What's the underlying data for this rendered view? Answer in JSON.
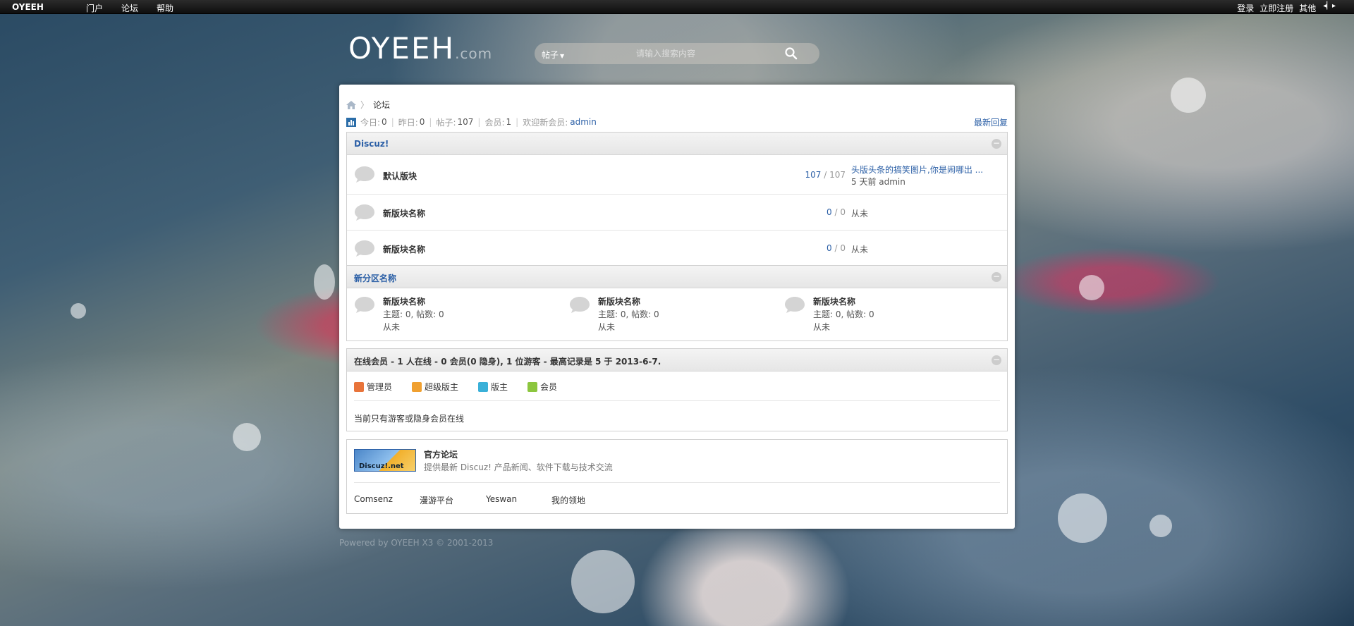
{
  "topbar": {
    "brand": "OYEEH",
    "nav": [
      "门户",
      "论坛",
      "帮助"
    ],
    "right": [
      "登录",
      "立即注册",
      "其他"
    ]
  },
  "header": {
    "logo": "OYEEH",
    "logo_suffix": ".com",
    "search_type": "帖子",
    "search_placeholder": "请输入搜索内容"
  },
  "breadcrumb": {
    "current": "论坛"
  },
  "stats": {
    "today_label": "今日:",
    "today": "0",
    "yesterday_label": "昨日:",
    "yesterday": "0",
    "posts_label": "帖子:",
    "posts": "107",
    "members_label": "会员:",
    "members": "1",
    "welcome_label": "欢迎新会员:",
    "new_member": "admin",
    "latest_reply": "最新回复"
  },
  "categories": [
    {
      "title": "Discuz!",
      "forums": [
        {
          "name": "默认版块",
          "threads": "107",
          "posts": "107",
          "last_title": "头版头条的搞笑图片,你是闹哪出 ...",
          "last_meta": "5 天前 admin"
        },
        {
          "name": "新版块名称",
          "threads": "0",
          "posts": "0",
          "last_title": "",
          "last_meta": "从未"
        },
        {
          "name": "新版块名称",
          "threads": "0",
          "posts": "0",
          "last_title": "",
          "last_meta": "从未"
        }
      ]
    },
    {
      "title": "新分区名称",
      "forums": [
        {
          "name": "新版块名称",
          "meta": "主题: 0, 帖数: 0",
          "last": "从未"
        },
        {
          "name": "新版块名称",
          "meta": "主题: 0, 帖数: 0",
          "last": "从未"
        },
        {
          "name": "新版块名称",
          "meta": "主题: 0, 帖数: 0",
          "last": "从未"
        }
      ]
    }
  ],
  "online": {
    "title": "在线会员 - 1 人在线 - 0 会员(0 隐身), 1 位游客 - 最高记录是 5 于 2013-6-7.",
    "legend": [
      {
        "label": "管理员",
        "color": "#e8743b"
      },
      {
        "label": "超级版主",
        "color": "#f0a030"
      },
      {
        "label": "版主",
        "color": "#3ab0d8"
      },
      {
        "label": "会员",
        "color": "#8cc63e"
      }
    ],
    "message": "当前只有游客或隐身会员在线"
  },
  "links": {
    "logo_text": "Discuz!.net",
    "site_name": "官方论坛",
    "site_desc": "提供最新 Discuz! 产品新闻、软件下载与技术交流",
    "items": [
      "Comsenz",
      "漫游平台",
      "Yeswan",
      "我的领地"
    ]
  },
  "footer": "Powered by OYEEH X3 © 2001-2013"
}
